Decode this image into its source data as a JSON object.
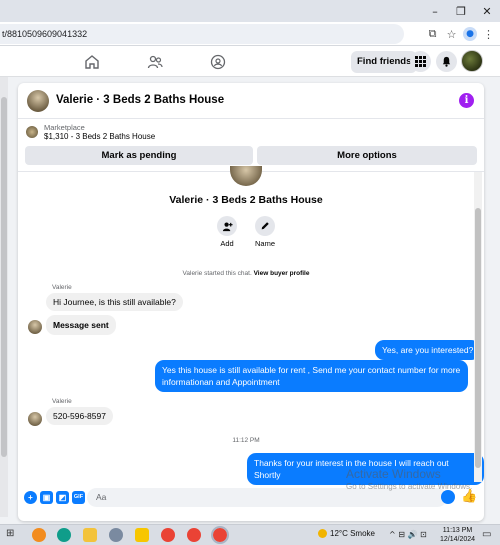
{
  "browser": {
    "url": "t/8810509609041332",
    "window_controls": [
      "–",
      "❐",
      "✕"
    ]
  },
  "nav": {
    "find_friends": "Find friends"
  },
  "chat": {
    "header_title": "Valerie · 3 Beds 2 Baths House",
    "listing_source": "Marketplace",
    "listing_desc": "$1,310 - 3 Beds 2 Baths House",
    "mark_pending": "Mark as pending",
    "more_options": "More options",
    "convo_title": "Valerie · 3 Beds 2 Baths House",
    "actions": {
      "add": "Add",
      "name": "Name"
    },
    "started_prefix": "Valerie started this chat.",
    "started_link": "View buyer profile",
    "messages": [
      {
        "sender": "Valerie",
        "text": "Hi Journee, is this still available?"
      },
      {
        "text": "Message sent"
      },
      {
        "text": "Yes, are you interested?"
      },
      {
        "text": "Yes this house is still available for rent , Send me your contact number for more informationan and Appointment"
      },
      {
        "sender": "Valerie",
        "text": "520-596-8597"
      },
      {
        "time": "11:12 PM"
      },
      {
        "text": "Thanks for your interest in the house I will reach out Shortly"
      }
    ],
    "composer_placeholder": "Aa"
  },
  "watermark": {
    "line1": "Activate Windows",
    "line2": "Go to Settings to activate Windows."
  },
  "taskbar": {
    "weather": "12°C  Smoke",
    "time": "11:13 PM",
    "date": "12/14/2024"
  },
  "colors": {
    "messenger_blue": "#0a7cff",
    "info_purple": "#a020f0"
  }
}
